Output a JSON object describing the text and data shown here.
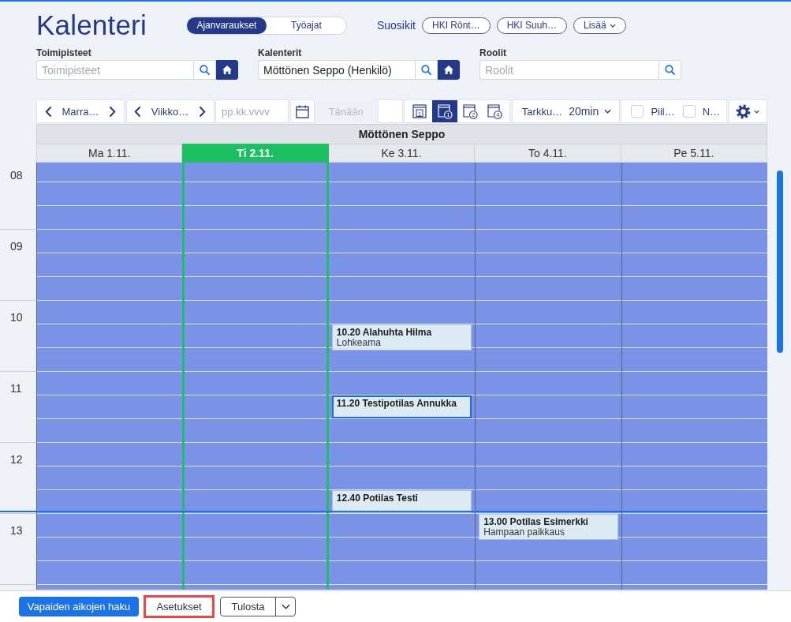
{
  "header": {
    "title": "Kalenteri",
    "modes": [
      {
        "label": "Ajanvaraukset",
        "selected": true
      },
      {
        "label": "Työajat",
        "selected": false
      }
    ],
    "favorites_label": "Suosikit",
    "favorites": [
      {
        "label": "HKI Rönt…"
      },
      {
        "label": "HKI Suuh…"
      }
    ],
    "more_label": "Lisää"
  },
  "filters": [
    {
      "label": "Toimipisteet",
      "placeholder": "Toimipisteet",
      "home_button": true
    },
    {
      "label": "Kalenterit",
      "value": "Möttönen Seppo (Henkilö)",
      "home_button": true
    },
    {
      "label": "Roolit",
      "placeholder": "Roolit",
      "home_button": false
    }
  ],
  "toolbar": {
    "month": "Marra…",
    "week": "Viikko…",
    "date_field": {
      "placeholder": "pp.kk.vvvv"
    },
    "today": {
      "label": "Tänään",
      "disabled": true
    },
    "views": [
      {
        "kind": "day",
        "label": "1",
        "selected": false
      },
      {
        "kind": "week",
        "label": "1",
        "selected": true
      },
      {
        "kind": "week",
        "label": "2",
        "selected": false
      },
      {
        "kind": "week",
        "label": "4",
        "selected": false
      }
    ],
    "resolution": {
      "label": "Tarkku…",
      "value": "20min"
    },
    "toggles": [
      {
        "label": "Piil…",
        "checked": false
      },
      {
        "label": "N…",
        "checked": false
      }
    ]
  },
  "calendar": {
    "title": "Möttönen Seppo",
    "hours": [
      "08",
      "09",
      "10",
      "11",
      "12",
      "13"
    ],
    "days": [
      {
        "label": "Ma 1.11.",
        "selected": false
      },
      {
        "label": "Ti 2.11.",
        "selected": true
      },
      {
        "label": "Ke 3.11.",
        "selected": false,
        "appointments": [
          {
            "title": "10.20 Alahuhta Hilma",
            "detail": "Lohkeama",
            "selected": false
          },
          {
            "title": "11.20 Testipotilas Annukka",
            "selected": true
          },
          {
            "title": "12.40 Potilas Testi",
            "selected": false
          }
        ]
      },
      {
        "label": "To 4.11.",
        "selected": false,
        "appointments": [
          {
            "title": "13.00 Potilas Esimerkki",
            "detail": "Hampaan paikkaus",
            "selected": false
          }
        ]
      },
      {
        "label": "Pe 5.11.",
        "selected": false
      }
    ]
  },
  "actions": [
    {
      "label": "Vapaiden aikojen haku",
      "kind": "primary",
      "focused": false
    },
    {
      "label": "Asetukset",
      "kind": "plain",
      "focused": true
    },
    {
      "label": "Tulosta",
      "kind": "split",
      "focused": false
    }
  ]
}
